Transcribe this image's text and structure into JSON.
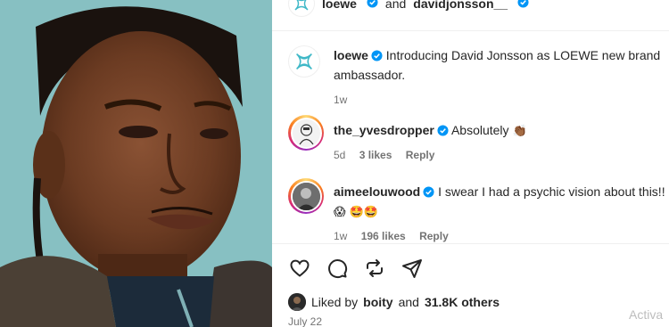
{
  "header": {
    "account": "loewe",
    "connector": "and",
    "collaborator": "davidjonsson__"
  },
  "caption": {
    "username": "loewe",
    "text": "Introducing David Jonsson as LOEWE new brand ambassador.",
    "time": "1w"
  },
  "comments": [
    {
      "username": "the_yvesdropper",
      "text": "Absolutely",
      "emoji": "👏🏾",
      "time": "5d",
      "likes": "3 likes",
      "reply": "Reply"
    },
    {
      "username": "aimeelouwood",
      "text": "I swear I had a psychic vision about this!!",
      "emoji": "😱 🤩🤩",
      "time": "1w",
      "likes": "196 likes",
      "reply": "Reply"
    }
  ],
  "actions": {
    "icons": [
      "heart-icon",
      "comment-icon",
      "repost-icon",
      "share-icon"
    ]
  },
  "likes_summary": {
    "prefix": "Liked by",
    "user": "boity",
    "conjunction": "and",
    "others": "31.8K others"
  },
  "post_date": "July 22",
  "watermark": "Activa",
  "colors": {
    "verified": "#0095f6",
    "loewe_logo": "#3fb8c7",
    "photo_background": "#8fc7c9"
  }
}
